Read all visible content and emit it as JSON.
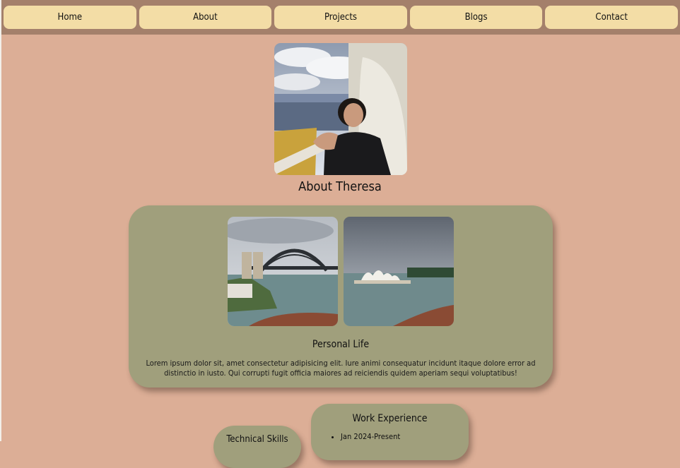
{
  "nav": {
    "items": [
      {
        "label": "Home"
      },
      {
        "label": "About"
      },
      {
        "label": "Projects"
      },
      {
        "label": "Blogs"
      },
      {
        "label": "Contact"
      }
    ]
  },
  "about": {
    "title": "About Theresa"
  },
  "personal": {
    "heading": "Personal Life",
    "text": "Lorem ipsum dolor sit, amet consectetur adipisicing elit. Iure animi consequatur incidunt itaque dolore error ad distinctio in iusto. Qui corrupti fugit officia maiores ad reiciendis quidem aperiam sequi voluptatibus!"
  },
  "work": {
    "heading": "Work Experience",
    "items": [
      "Jan 2024-Present"
    ]
  },
  "skills": {
    "heading": "Technical Skills"
  },
  "colors": {
    "page_bg": "#dcae96",
    "nav_bg": "#a4806b",
    "nav_button": "#f3dda6",
    "card_bg": "#a09f7c"
  }
}
